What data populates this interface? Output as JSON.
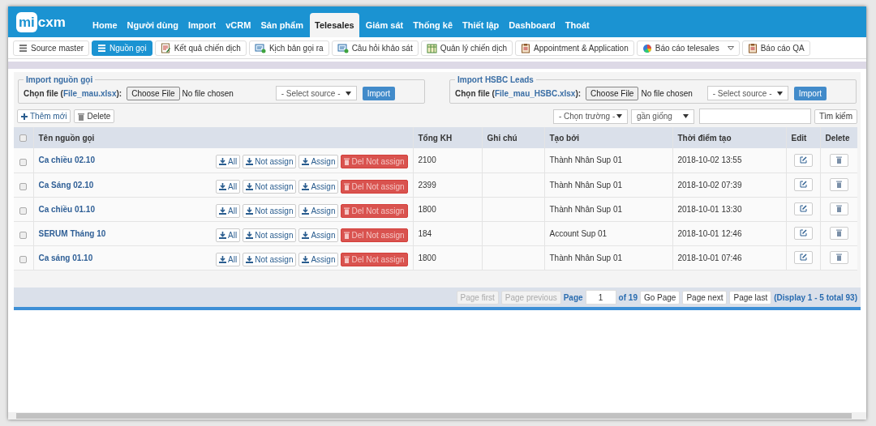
{
  "logo": {
    "part_1": "mi",
    "part_2": "cxm"
  },
  "nav": [
    {
      "label": "Home",
      "selected": false
    },
    {
      "label": "Người dùng",
      "selected": false
    },
    {
      "label": "Import",
      "selected": false
    },
    {
      "label": "vCRM",
      "selected": false
    },
    {
      "label": "Sản phẩm",
      "selected": false
    },
    {
      "label": "Telesales",
      "selected": true
    },
    {
      "label": "Giám sát",
      "selected": false
    },
    {
      "label": "Thống kê",
      "selected": false
    },
    {
      "label": "Thiết lập",
      "selected": false
    },
    {
      "label": "Dashboard",
      "selected": false
    },
    {
      "label": "Thoát",
      "selected": false
    }
  ],
  "subnav": [
    {
      "label": "Source master",
      "selected": false
    },
    {
      "label": "Nguồn gọi",
      "selected": true
    },
    {
      "label": "Kết quả chiến dịch",
      "selected": false
    },
    {
      "label": "Kịch bản gọi ra",
      "selected": false
    },
    {
      "label": "Câu hỏi khảo sát",
      "selected": false
    },
    {
      "label": "Quản lý chiến dịch",
      "selected": false
    },
    {
      "label": "Appointment & Application",
      "selected": false
    },
    {
      "label": "Báo cáo telesales",
      "selected": false,
      "dropdown": true
    },
    {
      "label": "Báo cáo QA",
      "selected": false
    }
  ],
  "imports": [
    {
      "legend": "Import nguồn gọi",
      "label_before": "Chọn file (",
      "link": "File_mau.xlsx",
      "label_after": "):",
      "file_button": "Choose File",
      "file_status": "No file chosen",
      "source_select": "- Select source -",
      "import_button": "Import"
    },
    {
      "legend": "Import HSBC Leads",
      "label_before": "Chọn file (",
      "link": "File_mau_HSBC.xlsx",
      "label_after": "):",
      "file_button": "Choose File",
      "file_status": "No file chosen",
      "source_select": "- Select source -",
      "import_button": "Import"
    }
  ],
  "toolbar": {
    "add_button": "Thêm mới",
    "delete_button": "Delete",
    "field_select": "- Chọn trường -",
    "match_select": "gần giống",
    "search_button": "Tìm kiếm"
  },
  "table": {
    "select_all_checked": false,
    "columns": [
      "Tên nguồn gọi",
      "Tổng KH",
      "Ghi chú",
      "Tạo bởi",
      "Thời điểm tạo",
      "Edit",
      "Delete"
    ],
    "rows": [
      {
        "checked": false,
        "name": "Ca chiều 02.10",
        "actions": [
          "All",
          "Not assign",
          "Assign",
          "Del Not assign"
        ],
        "total": "2100",
        "created_by": "Thành Nhân Sup 01",
        "created_at": "2018-10-02 13:55"
      },
      {
        "checked": false,
        "name": "Ca Sáng 02.10",
        "actions": [
          "All",
          "Not assign",
          "Assign",
          "Del Not assign"
        ],
        "total": "2399",
        "created_by": "Thành Nhân Sup 01",
        "created_at": "2018-10-02 07:39"
      },
      {
        "checked": false,
        "name": "Ca chiều 01.10",
        "actions": [
          "All",
          "Not assign",
          "Assign",
          "Del Not assign"
        ],
        "total": "1800",
        "created_by": "Thành Nhân Sup 01",
        "created_at": "2018-10-01 13:30"
      },
      {
        "checked": false,
        "name": "SERUM Tháng 10",
        "actions": [
          "All",
          "Not assign",
          "Assign",
          "Del Not assign"
        ],
        "total": "184",
        "created_by": "Account Sup 01",
        "created_at": "2018-10-01 12:46"
      },
      {
        "checked": false,
        "name": "Ca sáng 01.10",
        "actions": [
          "All",
          "Not assign",
          "Assign",
          "Del Not assign"
        ],
        "total": "1800",
        "created_by": "Thành Nhân Sup 01",
        "created_at": "2018-10-01 07:46"
      }
    ]
  },
  "pagination": {
    "first": "Page first",
    "previous": "Page previous",
    "page_label": "Page",
    "page": "1",
    "of": "of 19",
    "go": "Go Page",
    "next": "Page next",
    "last": "Page last",
    "display": "(Display 1 - 5 total 93)"
  }
}
